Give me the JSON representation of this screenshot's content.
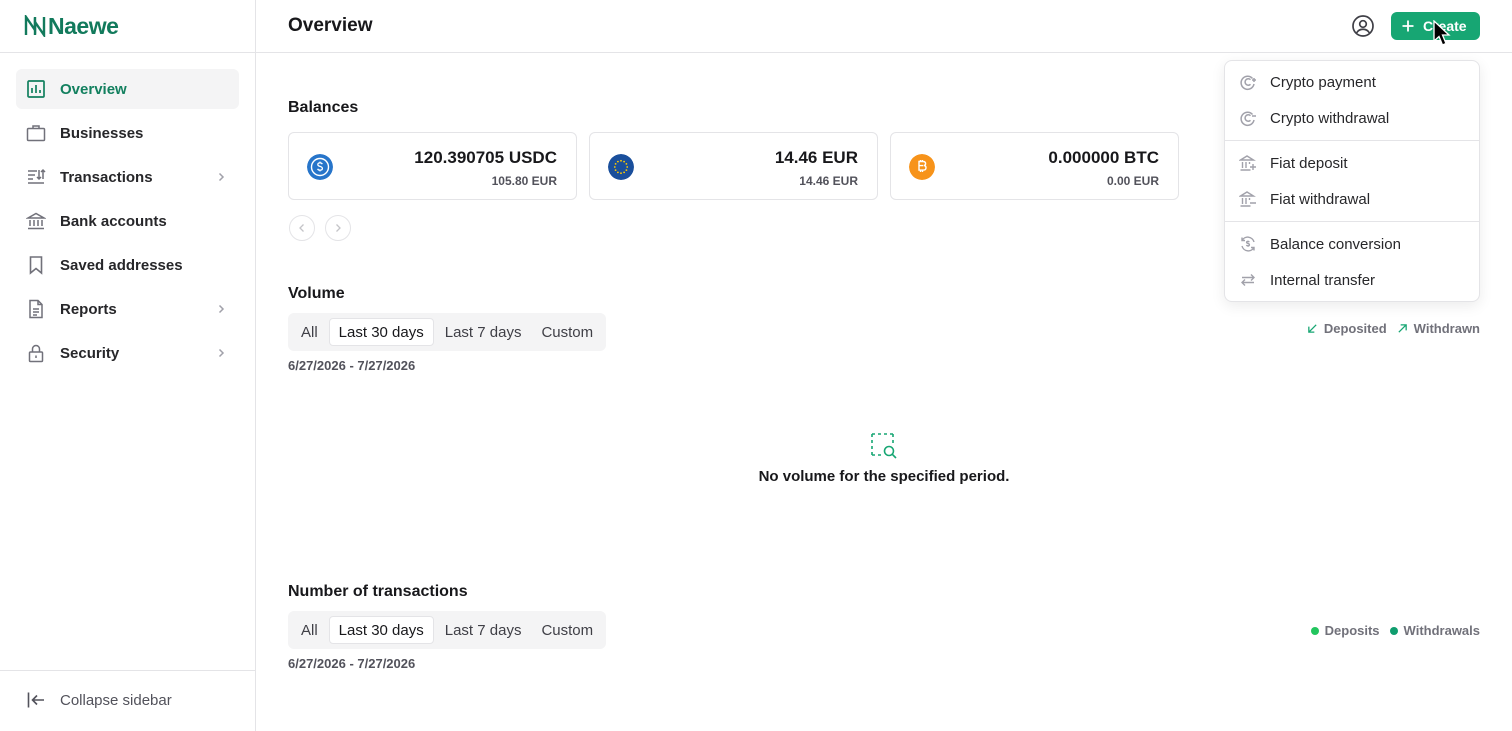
{
  "brand": {
    "name": "Naewe",
    "color": "#127a5c"
  },
  "accent": "#17a673",
  "sidebar": {
    "items": [
      {
        "label": "Overview",
        "icon": "bar-chart-icon",
        "active": true
      },
      {
        "label": "Businesses",
        "icon": "briefcase-icon"
      },
      {
        "label": "Transactions",
        "icon": "transactions-icon",
        "expandable": true
      },
      {
        "label": "Bank accounts",
        "icon": "bank-icon"
      },
      {
        "label": "Saved addresses",
        "icon": "bookmark-icon"
      },
      {
        "label": "Reports",
        "icon": "document-icon",
        "expandable": true
      },
      {
        "label": "Security",
        "icon": "lock-icon",
        "expandable": true
      }
    ],
    "collapse_label": "Collapse sidebar"
  },
  "header": {
    "title": "Overview",
    "create_label": "Create"
  },
  "balances": {
    "title": "Balances",
    "cards": [
      {
        "amount": "120.390705 USDC",
        "fiat": "105.80 EUR",
        "icon": "usdc-coin-icon",
        "color": "#2775ca"
      },
      {
        "amount": "14.46 EUR",
        "fiat": "14.46 EUR",
        "icon": "eur-coin-icon",
        "color": "#1a4f9c"
      },
      {
        "amount": "0.000000 BTC",
        "fiat": "0.00 EUR",
        "icon": "btc-coin-icon",
        "color": "#f7931a"
      }
    ]
  },
  "volume": {
    "title": "Volume",
    "filters": [
      "All",
      "Last 30 days",
      "Last 7 days",
      "Custom"
    ],
    "selected": "Last 30 days",
    "date_range": "6/27/2026 - 7/27/2026",
    "legend": [
      "Deposited",
      "Withdrawn"
    ],
    "empty_message": "No volume for the specified period."
  },
  "transactions_count": {
    "title": "Number of transactions",
    "filters": [
      "All",
      "Last 30 days",
      "Last 7 days",
      "Custom"
    ],
    "selected": "Last 30 days",
    "date_range": "6/27/2026 - 7/27/2026",
    "legend": [
      {
        "label": "Deposits",
        "color": "#22c55e"
      },
      {
        "label": "Withdrawals",
        "color": "#0f9d6e"
      }
    ]
  },
  "create_menu": {
    "groups": [
      [
        {
          "label": "Crypto payment",
          "icon": "crypto-payment-icon"
        },
        {
          "label": "Crypto withdrawal",
          "icon": "crypto-withdrawal-icon"
        }
      ],
      [
        {
          "label": "Fiat deposit",
          "icon": "bank-deposit-icon"
        },
        {
          "label": "Fiat withdrawal",
          "icon": "bank-withdrawal-icon"
        }
      ],
      [
        {
          "label": "Balance conversion",
          "icon": "conversion-icon"
        },
        {
          "label": "Internal transfer",
          "icon": "transfer-arrows-icon"
        }
      ]
    ]
  }
}
